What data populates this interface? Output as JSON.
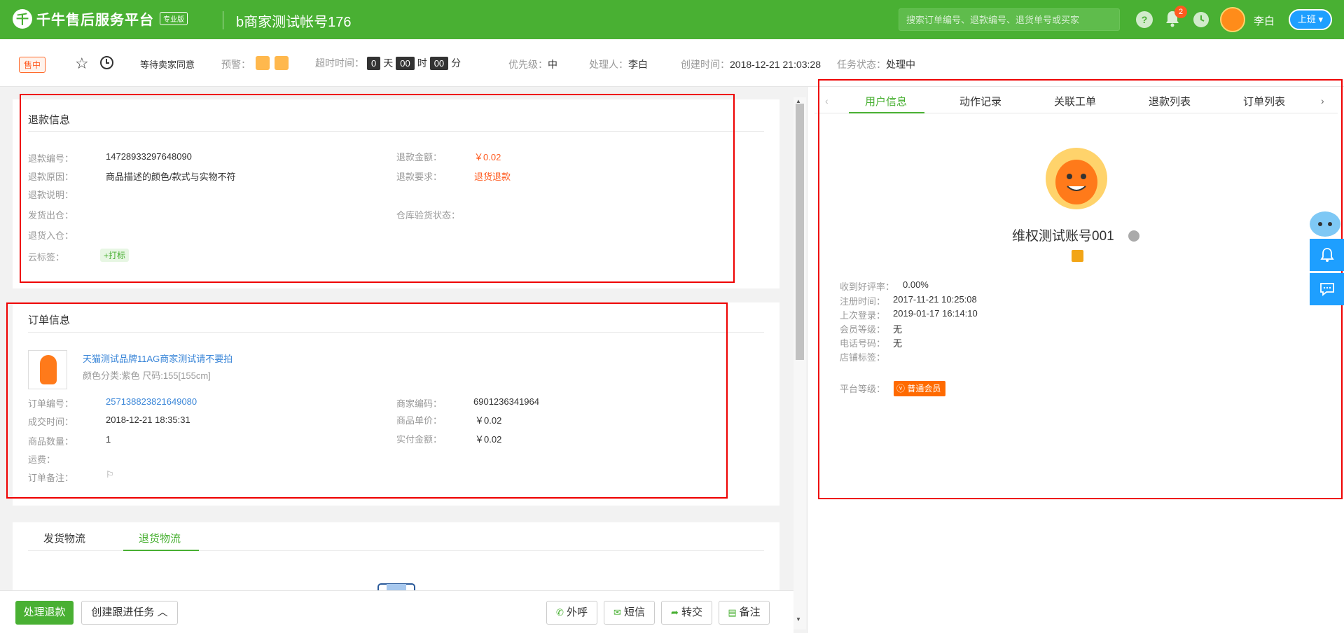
{
  "header": {
    "logo_mark": "千",
    "app_name": "千牛售后服务平台",
    "edition": "专业版",
    "account": "b商家测试帐号176",
    "search_placeholder": "搜索订单编号、退款编号、退货单号或买家",
    "help": "?",
    "notification_count": "2",
    "user": "李白",
    "duty_button": "上班"
  },
  "subbar": {
    "status": "售中",
    "stage": "等待卖家同意",
    "warning_label": "预警：",
    "timeout_label": "超时时间：",
    "days": "0",
    "day_unit": "天",
    "hours": "00",
    "hour_unit": "时",
    "minutes": "00",
    "minute_unit": "分",
    "priority_label": "优先级：",
    "priority": "中",
    "handler_label": "处理人：",
    "handler": "李白",
    "created_label": "创建时间：",
    "created": "2018-12-21 21:03:28",
    "task_status_label": "任务状态：",
    "task_status": "处理中"
  },
  "refund": {
    "title": "退款信息",
    "no_label": "退款编号：",
    "no": "14728933297648090",
    "amount_label": "退款金额：",
    "amount": "￥0.02",
    "reason_label": "退款原因：",
    "reason": "商品描述的颜色/款式与实物不符",
    "request_label": "退款要求：",
    "request": "退货退款",
    "note_label": "退款说明：",
    "ship_out_label": "发货出仓：",
    "inspect_label": "仓库验货状态：",
    "return_in_label": "退货入仓：",
    "cloud_tag_label": "云标签：",
    "tag_button": "+打标"
  },
  "order": {
    "title": "订单信息",
    "product_name": "天猫测试品牌11AG商家测试请不要拍",
    "product_sku": "颜色分类:紫色 尺码:155[155cm]",
    "order_no_label": "订单编号：",
    "order_no": "257138823821649080",
    "merchant_code_label": "商家编码：",
    "merchant_code": "6901236341964",
    "deal_time_label": "成交时间：",
    "deal_time": "2018-12-21 18:35:31",
    "unit_price_label": "商品单价：",
    "unit_price": "￥0.02",
    "qty_label": "商品数量：",
    "qty": "1",
    "paid_label": "实付金额：",
    "paid": "￥0.02",
    "freight_label": "运费：",
    "remark_label": "订单备注：",
    "remark_icon": "flag-icon"
  },
  "logistics": {
    "tabs": [
      "发货物流",
      "退货物流"
    ],
    "active_tab": 1
  },
  "actions": {
    "process_refund": "处理退款",
    "create_task": "创建跟进任务",
    "call": "外呼",
    "sms": "短信",
    "transfer": "转交",
    "remark": "备注"
  },
  "right": {
    "tabs": [
      "用户信息",
      "动作记录",
      "关联工单",
      "退款列表",
      "订单列表"
    ],
    "active_tab": 0,
    "username": "维权测试账号001",
    "good_rate_label": "收到好评率：",
    "good_rate": "0.00%",
    "register_label": "注册时间：",
    "register": "2017-11-21 10:25:08",
    "last_login_label": "上次登录：",
    "last_login": "2019-01-17 16:14:10",
    "member_level_label": "会员等级：",
    "member_level": "无",
    "phone_label": "电话号码：",
    "phone": "无",
    "shop_tag_label": "店铺标签：",
    "platform_level_label": "平台等级：",
    "platform_level": "普通会员"
  },
  "colors": {
    "brand_green": "#49b033",
    "accent_orange": "#ff5a1f",
    "link_blue": "#3a86d8",
    "highlight_red": "#e00000"
  }
}
